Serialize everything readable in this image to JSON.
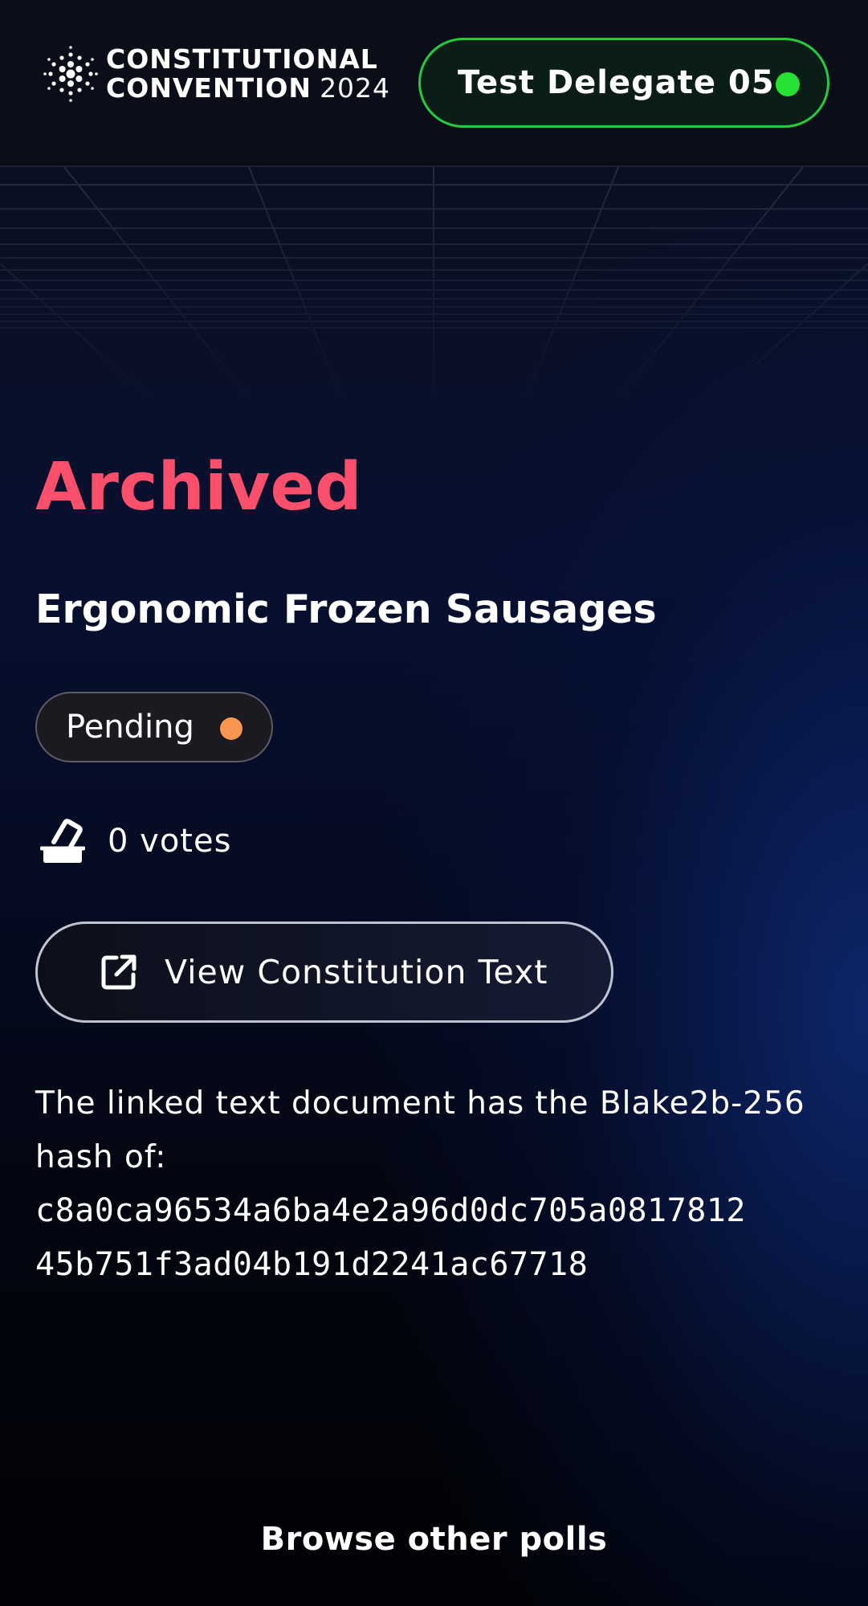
{
  "header": {
    "logo_line1": "CONSTITUTIONAL",
    "logo_line2": "CONVENTION",
    "logo_year": "2024",
    "delegate_label": "Test Delegate 05",
    "delegate_status_color": "#27e034"
  },
  "poll": {
    "status_heading": "Archived",
    "title": "Ergonomic Frozen Sausages",
    "badge_label": "Pending",
    "badge_color": "#f99650",
    "votes_label": "0 votes",
    "view_button_label": "View Constitution Text",
    "hash_intro": "The linked text document has the Blake2b-256 hash of:",
    "hash_value": "c8a0ca96534a6ba4e2a96d0dc705a081781245b751f3ad04b191d2241ac67718"
  },
  "footer": {
    "browse_label": "Browse other polls"
  },
  "colors": {
    "accent_red": "#fc4f6c",
    "active_green": "#27c93f"
  }
}
